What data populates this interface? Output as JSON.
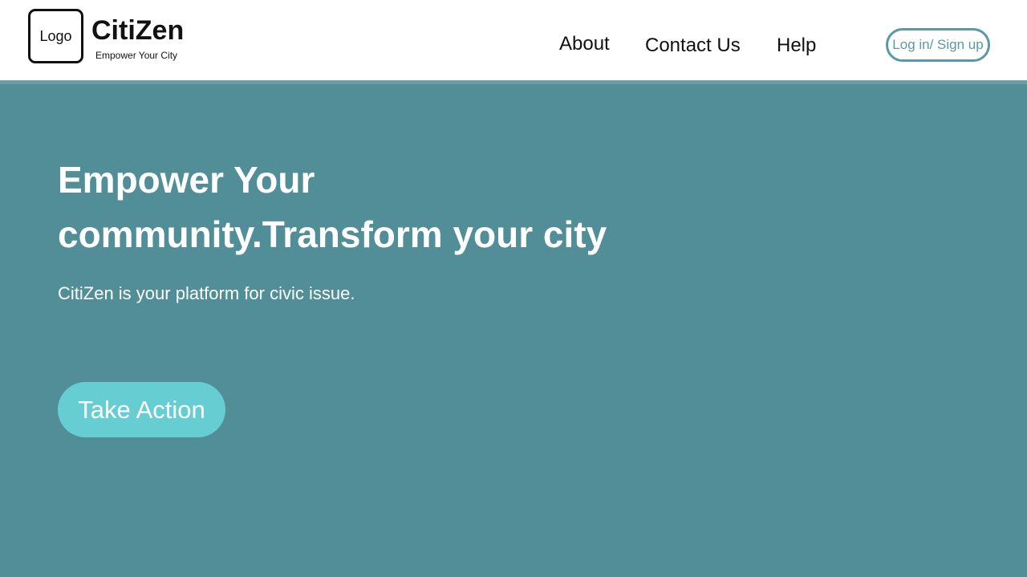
{
  "header": {
    "logo_text": "Logo",
    "brand_name": "CitiZen",
    "tagline": "Empower Your City",
    "nav": {
      "about": "About",
      "contact": "Contact Us",
      "help": "Help"
    },
    "login_label": "Log in/ Sign up"
  },
  "hero": {
    "title_line1": "Empower Your",
    "title_line2": "community.Transform your city",
    "subtitle": "CitiZen is your platform for civic issue.",
    "cta_label": "Take Action"
  },
  "colors": {
    "hero_background": "#518e98",
    "header_background": "#ffffff",
    "accent_outline": "#5a9aa4",
    "cta_background": "#66cdd3",
    "text_dark": "#111111",
    "text_light": "#ffffff"
  }
}
